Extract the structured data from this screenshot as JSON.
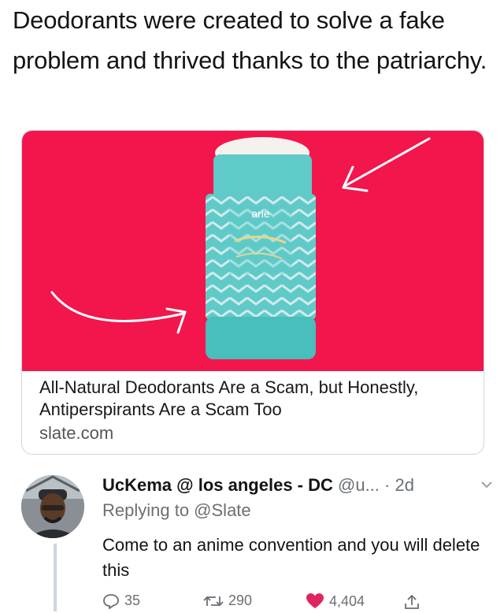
{
  "caption": "Deodorants were created to solve a fake problem and thrived thanks to the patriarchy.",
  "card": {
    "title": "All-Natural Deodorants Are a Scam, but Honestly, Antiperspirants Are a Scam Too",
    "domain": "slate.com",
    "product_brand": "arie"
  },
  "tweet": {
    "name": "UcKema @ los angeles - DC",
    "handle": "@u...",
    "time": "· 2d",
    "replying_to": "Replying to @Slate",
    "text": "Come to an anime convention and you will delete this",
    "replies": "35",
    "retweets": "290",
    "likes": "4,404"
  },
  "colors": {
    "card_background": "#f2164c",
    "like_heart": "#e0245e",
    "secondary_text": "#6a6f74"
  },
  "icons": [
    "arrow-pointer-icon",
    "curved-arrow-icon",
    "reply-icon",
    "retweet-icon",
    "heart-icon",
    "share-icon",
    "chevron-down-icon"
  ]
}
